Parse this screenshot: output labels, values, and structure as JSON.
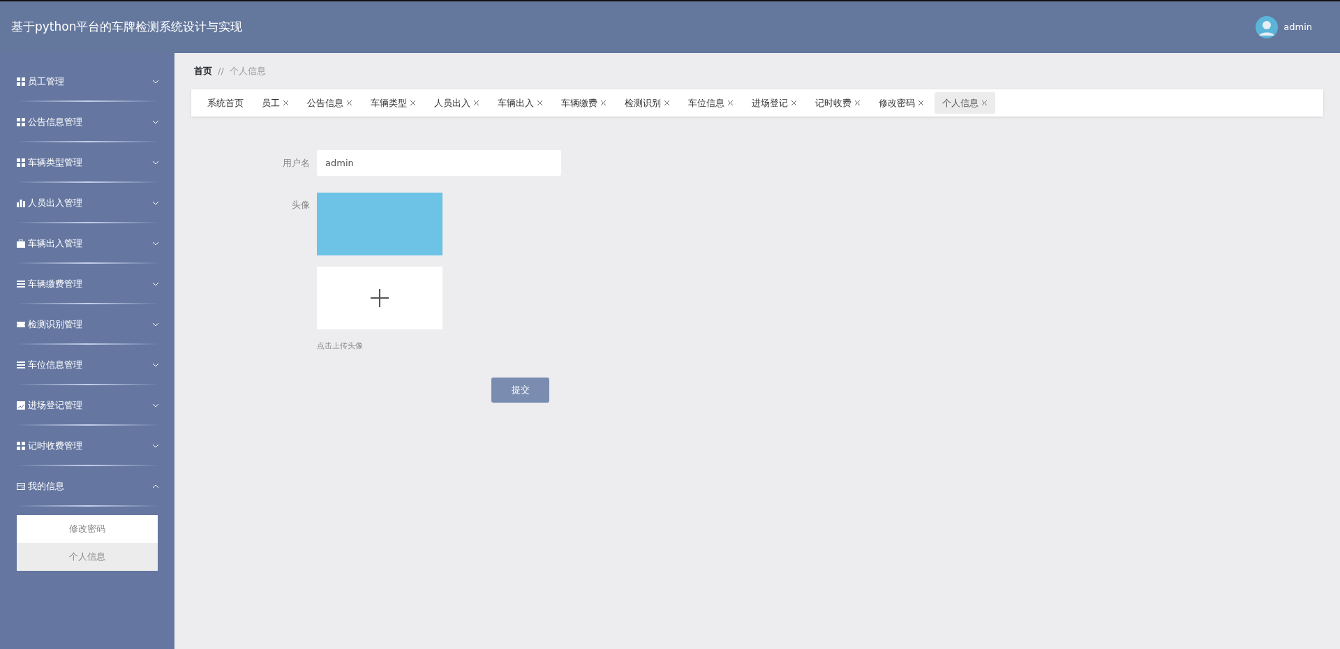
{
  "header": {
    "title": "基于python平台的车牌检测系统设计与实现",
    "user": "admin"
  },
  "sidebar": {
    "items": [
      {
        "label": "员工管理",
        "expanded": false
      },
      {
        "label": "公告信息管理",
        "expanded": false
      },
      {
        "label": "车辆类型管理",
        "expanded": false
      },
      {
        "label": "人员出入管理",
        "expanded": false
      },
      {
        "label": "车辆出入管理",
        "expanded": false
      },
      {
        "label": "车辆缴费管理",
        "expanded": false
      },
      {
        "label": "检测识别管理",
        "expanded": false
      },
      {
        "label": "车位信息管理",
        "expanded": false
      },
      {
        "label": "进场登记管理",
        "expanded": false
      },
      {
        "label": "记时收费管理",
        "expanded": false
      },
      {
        "label": "我的信息",
        "expanded": true,
        "children": [
          {
            "label": "修改密码",
            "selected": false
          },
          {
            "label": "个人信息",
            "selected": true
          }
        ]
      }
    ]
  },
  "breadcrumb": {
    "home": "首页",
    "separator": "//",
    "current": "个人信息"
  },
  "tabs": [
    {
      "label": "系统首页",
      "closable": false,
      "selected": false
    },
    {
      "label": "员工",
      "closable": true,
      "selected": false
    },
    {
      "label": "公告信息",
      "closable": true,
      "selected": false
    },
    {
      "label": "车辆类型",
      "closable": true,
      "selected": false
    },
    {
      "label": "人员出入",
      "closable": true,
      "selected": false
    },
    {
      "label": "车辆出入",
      "closable": true,
      "selected": false
    },
    {
      "label": "车辆缴费",
      "closable": true,
      "selected": false
    },
    {
      "label": "检测识别",
      "closable": true,
      "selected": false
    },
    {
      "label": "车位信息",
      "closable": true,
      "selected": false
    },
    {
      "label": "进场登记",
      "closable": true,
      "selected": false
    },
    {
      "label": "记时收费",
      "closable": true,
      "selected": false
    },
    {
      "label": "修改密码",
      "closable": true,
      "selected": false
    },
    {
      "label": "个人信息",
      "closable": true,
      "selected": true
    }
  ],
  "form": {
    "username_label": "用户名",
    "username": "admin",
    "avatar_label": "头像",
    "upload_hint": "点击上传头像",
    "submit": "提交"
  }
}
